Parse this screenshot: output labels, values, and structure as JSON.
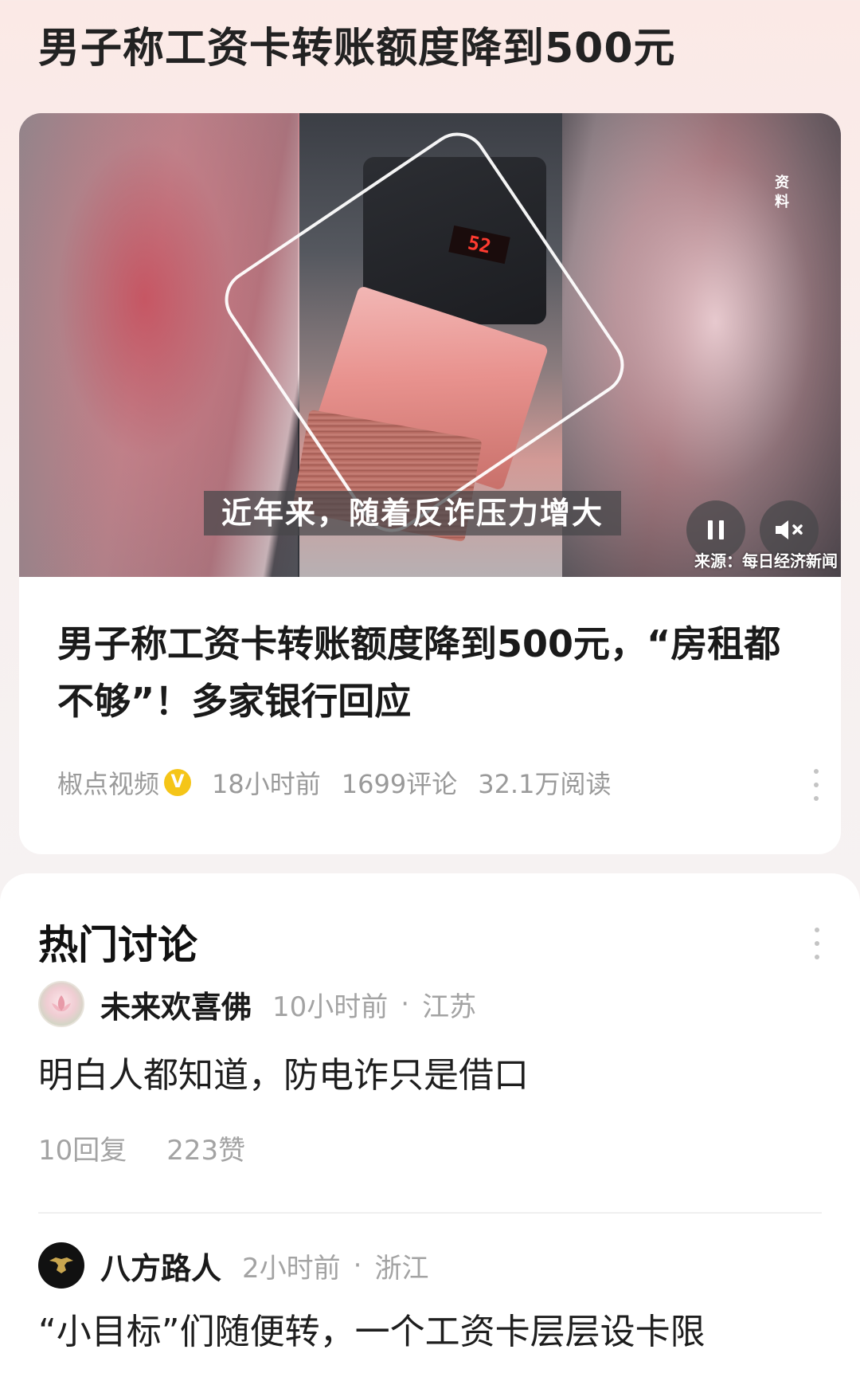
{
  "page": {
    "title": "男子称工资卡转账额度降到500元"
  },
  "news": {
    "video": {
      "side_label": "资料",
      "subtitle": "近年来，随着反诈压力增大",
      "counter_reading": "52",
      "source": "来源：每日经济新闻"
    },
    "headline": "男子称工资卡转账额度降到500元，“房租都不够”！多家银行回应",
    "meta": {
      "author": "椒点视频",
      "verified_badge": "V",
      "time": "18小时前",
      "comments": "1699评论",
      "reads": "32.1万阅读"
    }
  },
  "discussion": {
    "title": "热门讨论",
    "comments": [
      {
        "user": "未来欢喜佛",
        "time": "10小时前",
        "location": "江苏",
        "text": "明白人都知道，防电诈只是借口",
        "replies": "10回复",
        "likes": "223赞"
      },
      {
        "user": "八方路人",
        "time": "2小时前",
        "location": "浙江",
        "text": "“小目标”们随便转，一个工资卡层层设卡限"
      }
    ]
  }
}
